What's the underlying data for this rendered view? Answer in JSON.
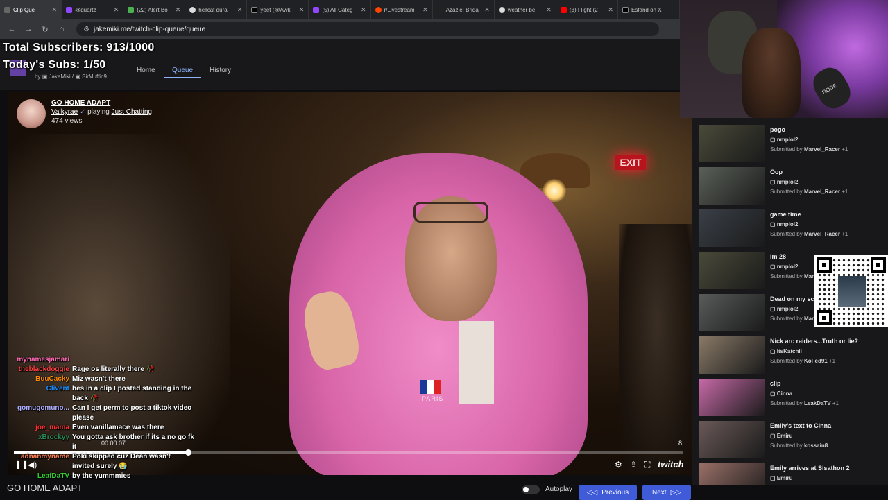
{
  "browser": {
    "tabs": [
      {
        "label": "Clip Que",
        "active": true
      },
      {
        "label": "@quartz"
      },
      {
        "label": "(22) Alert Bo"
      },
      {
        "label": "hellcat dura"
      },
      {
        "label": "yeet (@Awk"
      },
      {
        "label": "(5) All Categ"
      },
      {
        "label": "r/Livestream"
      },
      {
        "label": "Azazie: Brida"
      },
      {
        "label": "weather be"
      },
      {
        "label": "(3) Flight (2"
      },
      {
        "label": "Esfand on X"
      }
    ],
    "url": "jakemiki.me/twitch-clip-queue/queue"
  },
  "overlay": {
    "total_subs": "Total Subscribers: 913/1000",
    "today_subs": "Today's Subs: 1/50"
  },
  "site": {
    "by": "by",
    "author1": "JakeMiki",
    "sep": "/",
    "author2": "SirMuffin9",
    "nav": {
      "home": "Home",
      "queue": "Queue",
      "history": "History"
    }
  },
  "clip": {
    "title": "GO HOME ADAPT",
    "channel": "Valkyrae",
    "playing_label": "playing",
    "category": "Just Chatting",
    "views": "474 views",
    "timecode": "00:00:07",
    "counter": "8",
    "progress": 0.26,
    "brand": "twitch",
    "scene_exit_sign": "EXIT",
    "scene_shirt_text": "PARIS"
  },
  "chat": [
    {
      "name": "mynamesjamari",
      "color": "#ff69b4",
      "msg": ""
    },
    {
      "name": "theblackdoggie",
      "color": "#ff4040",
      "msg": "Rage os literally there 🥀"
    },
    {
      "name": "BuuCacky",
      "color": "#ff8c00",
      "msg": "Miz wasn't there"
    },
    {
      "name": "Clivent",
      "color": "#1e90ff",
      "msg": "hes in a clip I posted standing in the back 🥀"
    },
    {
      "name": "gomugomuno...",
      "color": "#b0b0ff",
      "msg": "Can I get perm to post a tiktok video please"
    },
    {
      "name": "joe_mama",
      "color": "#ff3030",
      "msg": "Even vanillamace was there"
    },
    {
      "name": "xBrockyy",
      "color": "#2e8b57",
      "msg": "You gotta ask brother if its a no go fk it"
    },
    {
      "name": "adnanmyname",
      "color": "#ff7f50",
      "msg": "Poki skipped cuz Dean wasn't invited surely 😭"
    },
    {
      "name": "LeafDaTV",
      "color": "#32cd32",
      "msg": "by the yummmies"
    }
  ],
  "bottom": {
    "title": "GO HOME ADAPT",
    "autoplay": "Autoplay",
    "previous": "Previous",
    "next": "Next"
  },
  "webcam": {
    "mic_brand": "RØDE"
  },
  "queue": [
    {
      "title": "pogo",
      "channel": "nmplol2",
      "submitted_label": "Submitted by",
      "by": "Marvel_Racer",
      "extra": "+1",
      "thumb": "#4a4a3a"
    },
    {
      "title": "Oop",
      "channel": "nmplol2",
      "submitted_label": "Submitted by",
      "by": "Marvel_Racer",
      "extra": "+1",
      "thumb": "#5a6058"
    },
    {
      "title": "game time",
      "channel": "nmplol2",
      "submitted_label": "Submitted by",
      "by": "Marvel_Racer",
      "extra": "+1",
      "thumb": "#3a4048"
    },
    {
      "title": "im 28",
      "channel": "nmplol2",
      "submitted_label": "Submitted by",
      "by": "Marvel_Racer",
      "extra": "+1",
      "thumb": "#4a4a3a"
    },
    {
      "title": "Dead on my screen",
      "channel": "nmplol2",
      "submitted_label": "Submitted by",
      "by": "Marvel_Racer",
      "extra": "+1",
      "thumb": "#585c5a"
    },
    {
      "title": "Nick arc raiders...Truth or lie?",
      "channel": "itsKatchii",
      "submitted_label": "Submitted by",
      "by": "KoFed91",
      "extra": "+1",
      "thumb": "#8a7a68"
    },
    {
      "title": "clip",
      "channel": "Cinna",
      "submitted_label": "Submitted by",
      "by": "LeakDaTV",
      "extra": "+1",
      "thumb": "#c86aa8"
    },
    {
      "title": "Emily's text to Cinna",
      "channel": "Emiru",
      "submitted_label": "Submitted by",
      "by": "kossain8",
      "extra": "",
      "thumb": "#6a5a58"
    },
    {
      "title": "Emily arrives at Sisathon 2",
      "channel": "Emiru",
      "submitted_label": "Submitted by",
      "by": "",
      "extra": "",
      "thumb": "#9a7068"
    }
  ],
  "colors": {
    "accent": "#3f5bd8",
    "nav_active": "#8fb4ff",
    "twitch_purple": "#6441a5"
  }
}
